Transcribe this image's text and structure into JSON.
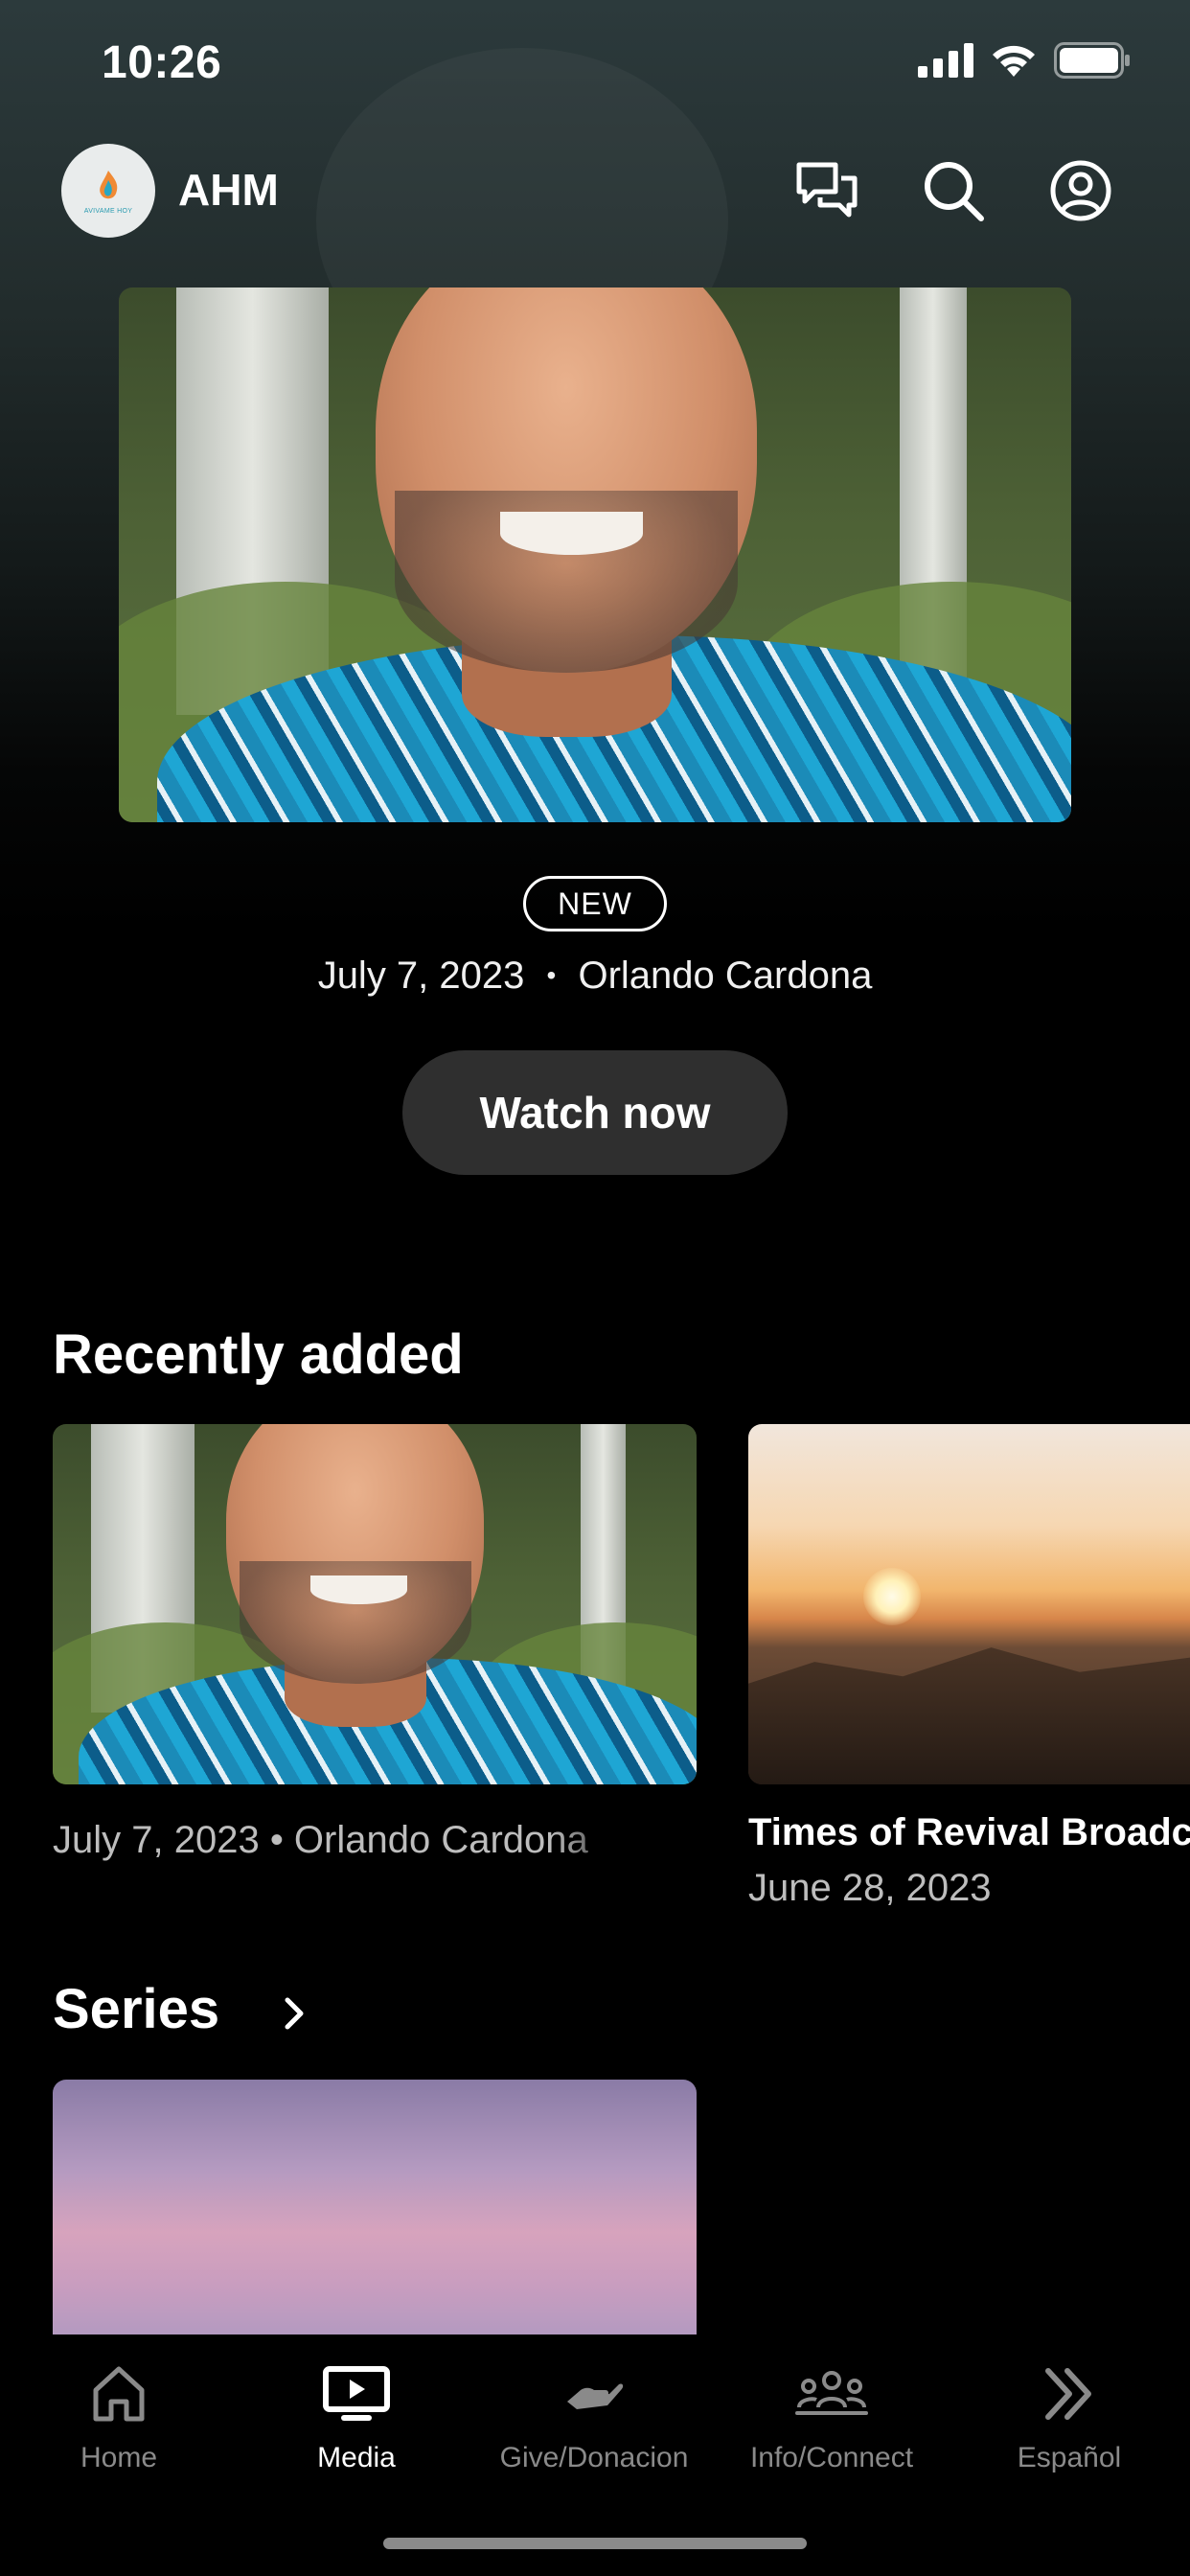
{
  "status_bar": {
    "time": "10:26"
  },
  "header": {
    "app_title": "AHM",
    "logo_text": "AVIVAME HOY",
    "icons": [
      "chat-icon",
      "search-icon",
      "profile-icon"
    ]
  },
  "hero": {
    "badge": "NEW",
    "date": "July 7, 2023",
    "separator": "•",
    "speaker": "Orlando Cardona",
    "button_label": "Watch now"
  },
  "recently_added": {
    "title": "Recently added",
    "cards": [
      {
        "meta": "July 7, 2023 • Orlando Cardona"
      },
      {
        "title": "Times of Revival Broadcast",
        "meta": "June 28, 2023"
      }
    ]
  },
  "series": {
    "title": "Series"
  },
  "tab_bar": {
    "tabs": [
      {
        "label": "Home",
        "icon": "home-icon"
      },
      {
        "label": "Media",
        "icon": "media-icon",
        "active": true
      },
      {
        "label": "Give/Donacion",
        "icon": "give-icon"
      },
      {
        "label": "Info/Connect",
        "icon": "people-icon"
      },
      {
        "label": "Español",
        "icon": "double-chevron-icon"
      }
    ]
  },
  "colors": {
    "background": "#000000",
    "button_bg": "#2f2f2f",
    "inactive_tab": "#8a8a8a"
  }
}
